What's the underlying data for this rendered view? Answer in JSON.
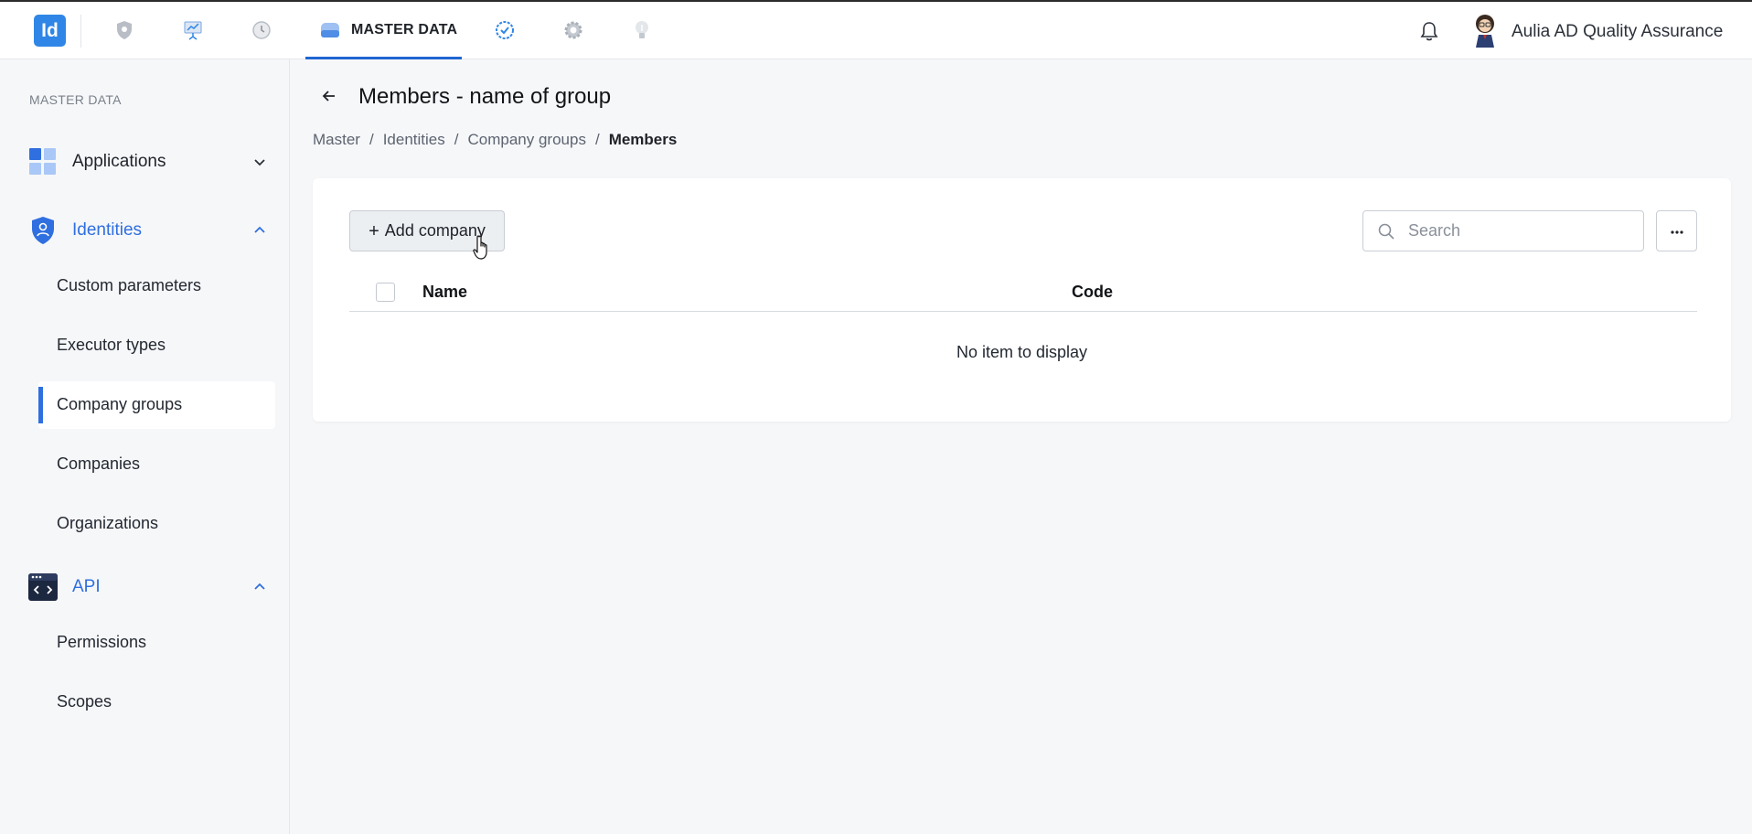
{
  "app": {
    "logo_text": "Id",
    "active_tab": "MASTER DATA",
    "user_name": "Aulia AD Quality Assurance",
    "accent_color": "#2166d3"
  },
  "topnav": {
    "icons": [
      "shield-icon",
      "presentation-icon",
      "clock-icon",
      "database-icon",
      "check-badge-icon",
      "gear-icon",
      "lightbulb-icon"
    ]
  },
  "sidebar": {
    "heading": "MASTER DATA",
    "groups": [
      {
        "label": "Applications",
        "expanded": false
      },
      {
        "label": "Identities",
        "expanded": true,
        "items": [
          "Custom parameters",
          "Executor types",
          "Company groups",
          "Companies",
          "Organizations"
        ]
      },
      {
        "label": "API",
        "expanded": true,
        "items": [
          "Permissions",
          "Scopes"
        ]
      }
    ],
    "active_item": "Company groups"
  },
  "page": {
    "title": "Members - name of group",
    "breadcrumb": [
      "Master",
      "Identities",
      "Company groups",
      "Members"
    ],
    "breadcrumb_sep": "/"
  },
  "toolbar": {
    "add_label": "Add company",
    "add_plus": "+",
    "search_placeholder": "Search"
  },
  "table": {
    "columns": [
      "Name",
      "Code"
    ],
    "empty_text": "No item to display"
  }
}
